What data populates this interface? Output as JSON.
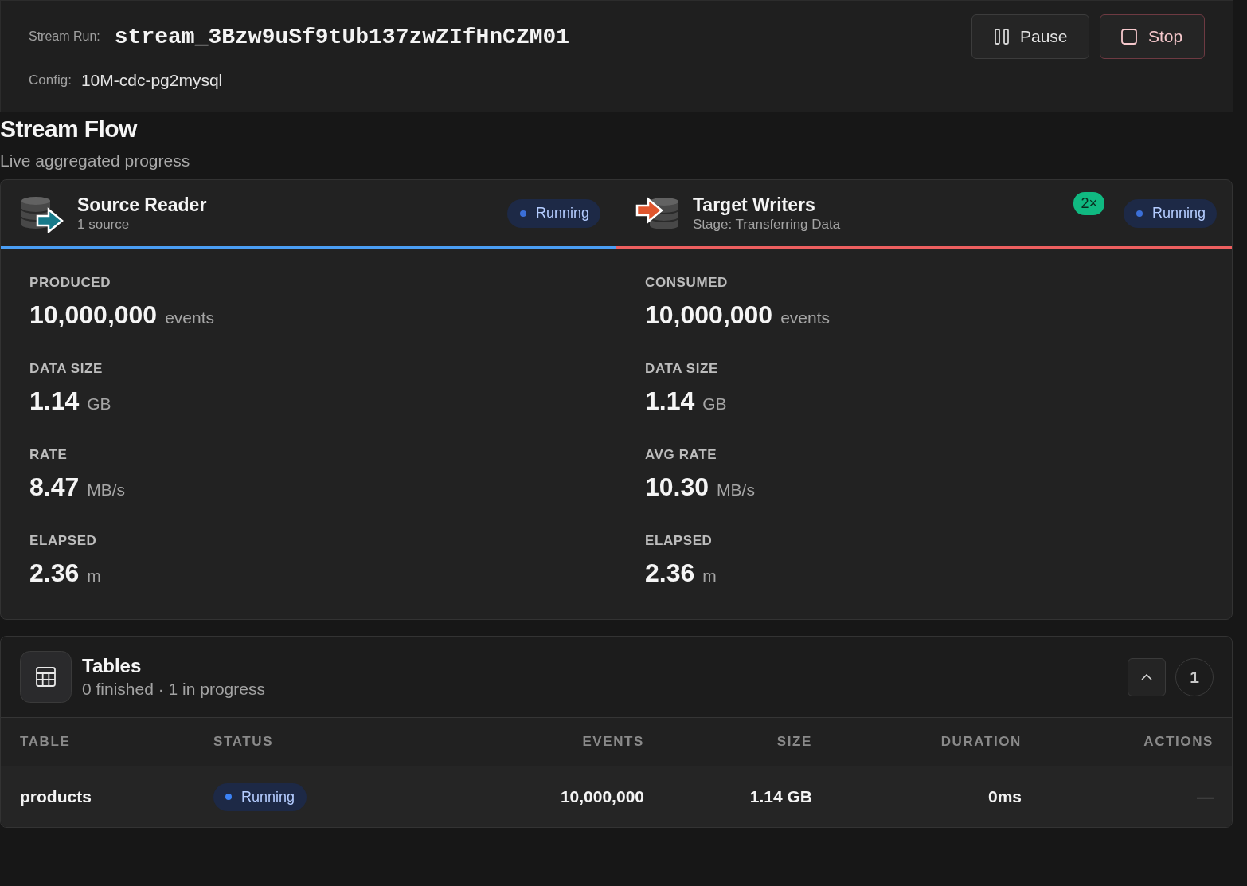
{
  "header": {
    "run_label": "Stream Run:",
    "run_id": "stream_3Bzw9uSf9tUb137zwZIfHnCZM01",
    "config_label": "Config:",
    "config_value": "10M-cdc-pg2mysql",
    "buttons": [
      {
        "kind": "pause",
        "label": "Pause"
      },
      {
        "kind": "stop",
        "label": "Stop"
      }
    ]
  },
  "flow": {
    "title": "Stream Flow",
    "subtitle": "Live aggregated progress",
    "panels": [
      {
        "kind": "source",
        "title": "Source Reader",
        "subtitle": "1 source",
        "status": {
          "label": "Running",
          "kind": "running"
        },
        "metrics": [
          {
            "label": "PRODUCED",
            "value": "10,000,000",
            "unit": "events"
          },
          {
            "label": "DATA SIZE",
            "value": "1.14",
            "unit": "GB"
          },
          {
            "label": "RATE",
            "value": "8.47",
            "unit": "MB/s"
          },
          {
            "label": "ELAPSED",
            "value": "2.36",
            "unit": "m"
          }
        ]
      },
      {
        "kind": "target",
        "title": "Target Writers",
        "subtitle": "Stage: Transferring Data",
        "multiplier": "2×",
        "status": {
          "label": "Running",
          "kind": "running"
        },
        "metrics": [
          {
            "label": "CONSUMED",
            "value": "10,000,000",
            "unit": "events"
          },
          {
            "label": "DATA SIZE",
            "value": "1.14",
            "unit": "GB"
          },
          {
            "label": "AVG RATE",
            "value": "10.30",
            "unit": "MB/s"
          },
          {
            "label": "ELAPSED",
            "value": "2.36",
            "unit": "m"
          }
        ]
      }
    ]
  },
  "tables": {
    "title": "Tables",
    "subtitle": "0 finished · 1 in progress",
    "expanded": true,
    "count": "1",
    "columns": [
      "TABLE",
      "STATUS",
      "EVENTS",
      "SIZE",
      "DURATION",
      "ACTIONS"
    ],
    "rows": [
      {
        "table": "products",
        "status": {
          "label": "Running",
          "kind": "running"
        },
        "events": "10,000,000",
        "size": "1.14 GB",
        "duration": "0ms",
        "actions": "—"
      }
    ]
  }
}
